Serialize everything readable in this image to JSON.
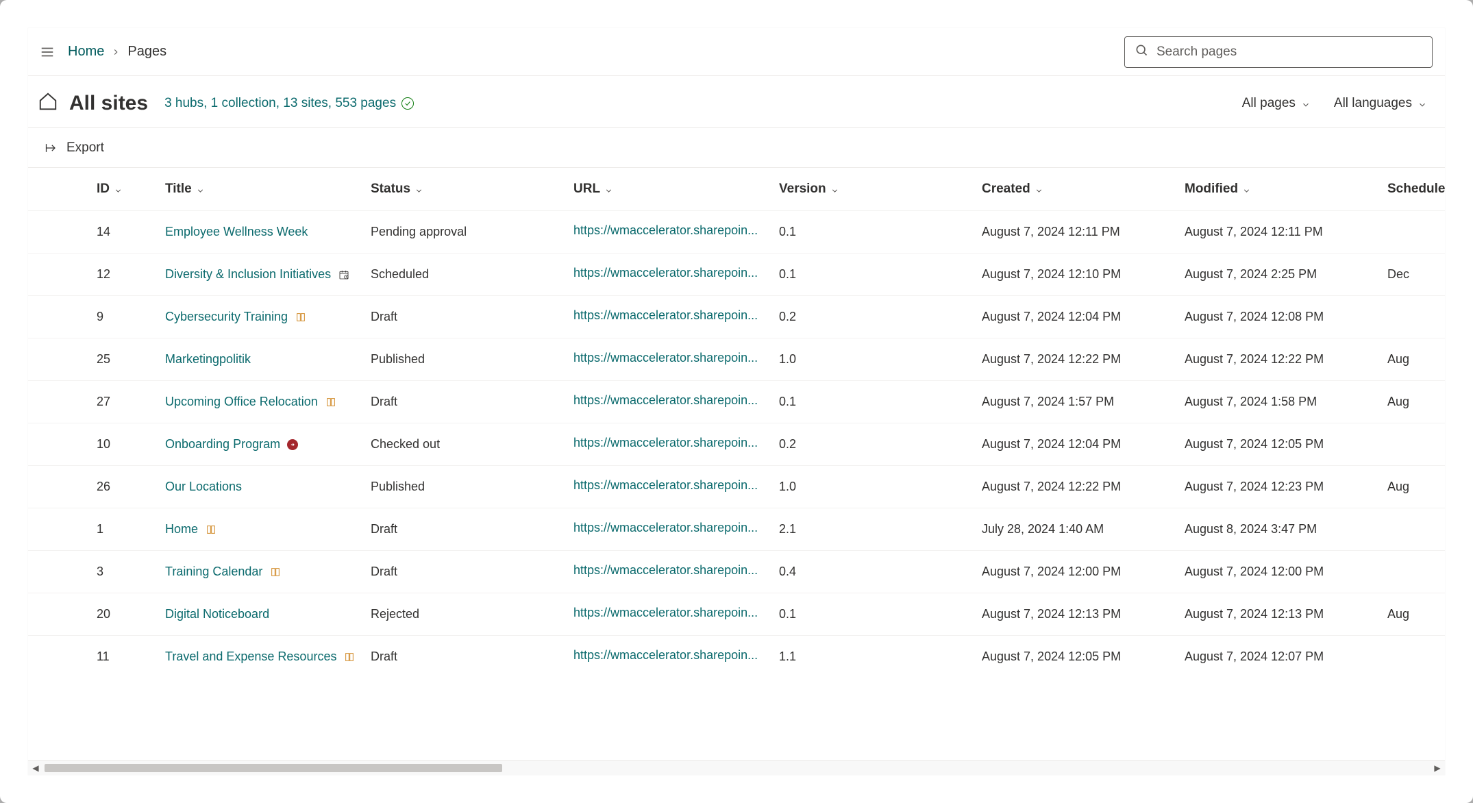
{
  "breadcrumbs": {
    "home": "Home",
    "current": "Pages"
  },
  "search": {
    "placeholder": "Search pages"
  },
  "header": {
    "title": "All sites",
    "summary": "3 hubs, 1 collection, 13 sites, 553 pages",
    "filter_pages": "All pages",
    "filter_lang": "All languages"
  },
  "toolbar": {
    "export": "Export"
  },
  "columns": {
    "id": "ID",
    "title": "Title",
    "status": "Status",
    "url": "URL",
    "version": "Version",
    "created": "Created",
    "modified": "Modified",
    "scheduled": "Scheduled"
  },
  "rows": [
    {
      "id": "14",
      "title": "Employee Wellness Week",
      "icon": null,
      "status": "Pending approval",
      "url": "https://wmaccelerator.sharepoin...",
      "version": "0.1",
      "created": "August 7, 2024 12:11 PM",
      "modified": "August 7, 2024 12:11 PM",
      "scheduled": ""
    },
    {
      "id": "12",
      "title": "Diversity & Inclusion Initiatives",
      "icon": "calendar",
      "status": "Scheduled",
      "url": "https://wmaccelerator.sharepoin...",
      "version": "0.1",
      "created": "August 7, 2024 12:10 PM",
      "modified": "August 7, 2024 2:25 PM",
      "scheduled": "Dec"
    },
    {
      "id": "9",
      "title": "Cybersecurity Training",
      "icon": "book",
      "status": "Draft",
      "url": "https://wmaccelerator.sharepoin...",
      "version": "0.2",
      "created": "August 7, 2024 12:04 PM",
      "modified": "August 7, 2024 12:08 PM",
      "scheduled": ""
    },
    {
      "id": "25",
      "title": "Marketingpolitik",
      "icon": null,
      "status": "Published",
      "url": "https://wmaccelerator.sharepoin...",
      "version": "1.0",
      "created": "August 7, 2024 12:22 PM",
      "modified": "August 7, 2024 12:22 PM",
      "scheduled": "Aug"
    },
    {
      "id": "27",
      "title": "Upcoming Office Relocation",
      "icon": "book",
      "status": "Draft",
      "url": "https://wmaccelerator.sharepoin...",
      "version": "0.1",
      "created": "August 7, 2024 1:57 PM",
      "modified": "August 7, 2024 1:58 PM",
      "scheduled": "Aug"
    },
    {
      "id": "10",
      "title": "Onboarding Program",
      "icon": "checkout",
      "status": "Checked out",
      "url": "https://wmaccelerator.sharepoin...",
      "version": "0.2",
      "created": "August 7, 2024 12:04 PM",
      "modified": "August 7, 2024 12:05 PM",
      "scheduled": ""
    },
    {
      "id": "26",
      "title": "Our Locations",
      "icon": null,
      "status": "Published",
      "url": "https://wmaccelerator.sharepoin...",
      "version": "1.0",
      "created": "August 7, 2024 12:22 PM",
      "modified": "August 7, 2024 12:23 PM",
      "scheduled": "Aug"
    },
    {
      "id": "1",
      "title": "Home",
      "icon": "book",
      "status": "Draft",
      "url": "https://wmaccelerator.sharepoin...",
      "version": "2.1",
      "created": "July 28, 2024 1:40 AM",
      "modified": "August 8, 2024 3:47 PM",
      "scheduled": ""
    },
    {
      "id": "3",
      "title": "Training Calendar",
      "icon": "book",
      "status": "Draft",
      "url": "https://wmaccelerator.sharepoin...",
      "version": "0.4",
      "created": "August 7, 2024 12:00 PM",
      "modified": "August 7, 2024 12:00 PM",
      "scheduled": ""
    },
    {
      "id": "20",
      "title": "Digital Noticeboard",
      "icon": null,
      "status": "Rejected",
      "url": "https://wmaccelerator.sharepoin...",
      "version": "0.1",
      "created": "August 7, 2024 12:13 PM",
      "modified": "August 7, 2024 12:13 PM",
      "scheduled": "Aug"
    },
    {
      "id": "11",
      "title": "Travel and Expense Resources",
      "icon": "book",
      "status": "Draft",
      "url": "https://wmaccelerator.sharepoin...",
      "version": "1.1",
      "created": "August 7, 2024 12:05 PM",
      "modified": "August 7, 2024 12:07 PM",
      "scheduled": ""
    }
  ]
}
